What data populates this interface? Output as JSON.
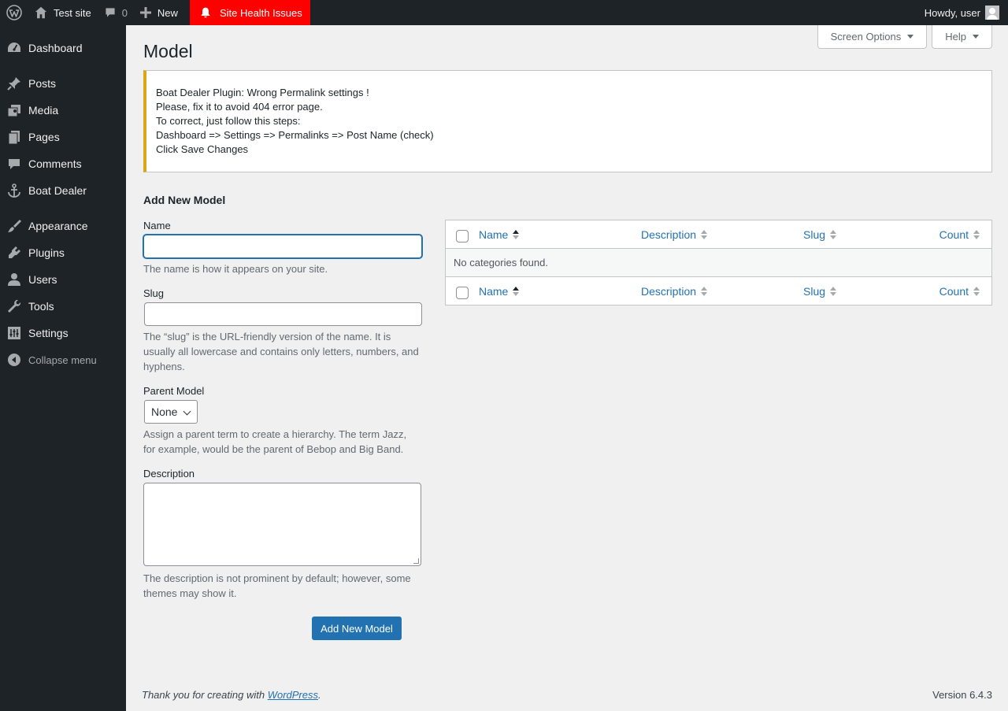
{
  "adminbar": {
    "site_name": "Test site",
    "comments_count": "0",
    "new_label": "New",
    "health_label": "Site Health Issues",
    "howdy": "Howdy, user"
  },
  "sidebar": {
    "items": [
      {
        "label": "Dashboard",
        "icon": "dashboard-icon"
      },
      {
        "label": "Posts",
        "icon": "pin-icon"
      },
      {
        "label": "Media",
        "icon": "media-icon"
      },
      {
        "label": "Pages",
        "icon": "pages-icon"
      },
      {
        "label": "Comments",
        "icon": "comment-icon"
      },
      {
        "label": "Boat Dealer",
        "icon": "anchor-icon"
      },
      {
        "label": "Appearance",
        "icon": "brush-icon"
      },
      {
        "label": "Plugins",
        "icon": "plugin-icon"
      },
      {
        "label": "Users",
        "icon": "user-icon"
      },
      {
        "label": "Tools",
        "icon": "wrench-icon"
      },
      {
        "label": "Settings",
        "icon": "sliders-icon"
      }
    ],
    "collapse_label": "Collapse menu"
  },
  "screen_meta": {
    "screen_options": "Screen Options",
    "help": "Help"
  },
  "page": {
    "title": "Model"
  },
  "notice": {
    "lines": [
      "Boat Dealer Plugin: Wrong Permalink settings !",
      "Please, fix it to avoid 404 error page.",
      "To correct, just follow this steps:",
      "Dashboard => Settings => Permalinks => Post Name (check)",
      "Click Save Changes"
    ]
  },
  "form": {
    "heading": "Add New Model",
    "name_label": "Name",
    "name_value": "",
    "name_desc": "The name is how it appears on your site.",
    "slug_label": "Slug",
    "slug_value": "",
    "slug_desc": "The “slug” is the URL-friendly version of the name. It is usually all lowercase and contains only letters, numbers, and hyphens.",
    "parent_label": "Parent Model",
    "parent_selected": "None",
    "parent_desc": "Assign a parent term to create a hierarchy. The term Jazz, for example, would be the parent of Bebop and Big Band.",
    "description_label": "Description",
    "description_value": "",
    "description_desc": "The description is not prominent by default; however, some themes may show it.",
    "submit_label": "Add New Model"
  },
  "table": {
    "columns": {
      "name": "Name",
      "description": "Description",
      "slug": "Slug",
      "count": "Count"
    },
    "empty_message": "No categories found."
  },
  "footer": {
    "thanks_prefix": "Thank you for creating with ",
    "wordpress_link": "WordPress",
    "thanks_suffix": ".",
    "version": "Version 6.4.3"
  },
  "colors": {
    "admin_dark": "#1d2327",
    "accent_blue": "#2271b1",
    "health_red": "#ff0000",
    "notice_warning": "#dba617"
  }
}
